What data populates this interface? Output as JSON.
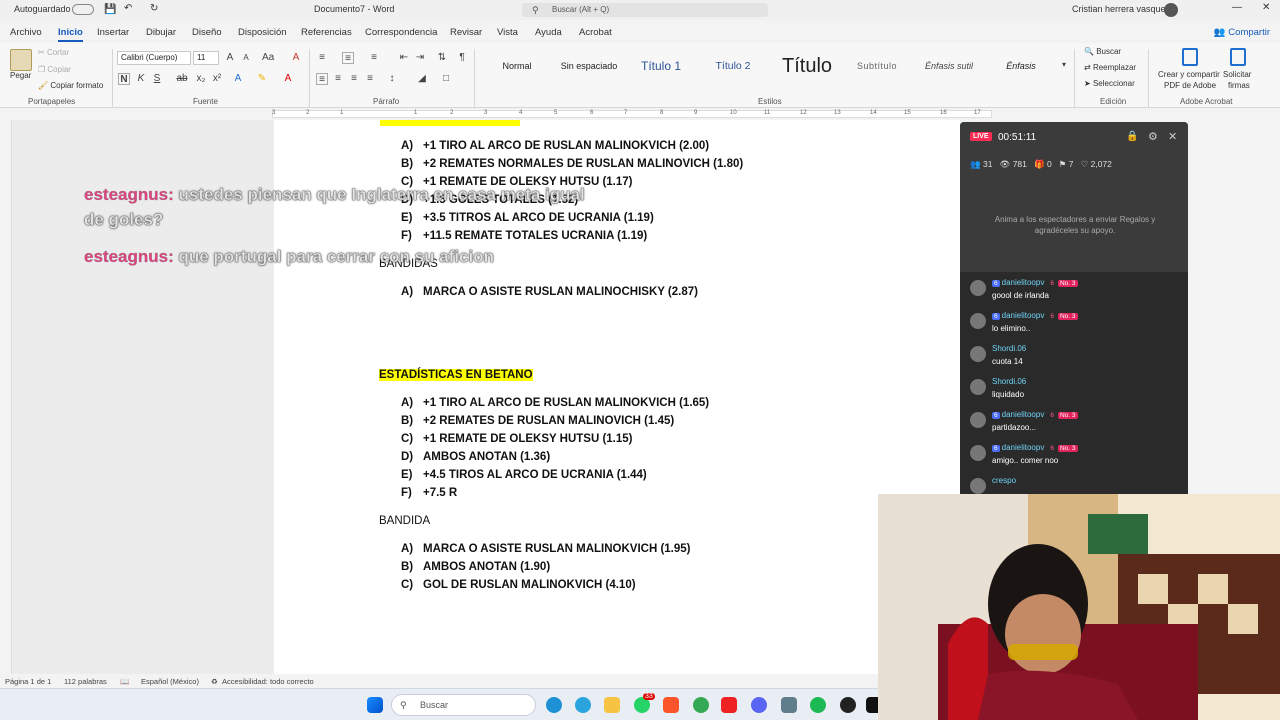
{
  "titlebar": {
    "autosave": "Autoguardado",
    "doc_title": "Documento7 - Word",
    "search_placeholder": "Buscar (Alt + Q)",
    "user_name": "Cristian herrera vasquez"
  },
  "tabs": [
    "Archivo",
    "Inicio",
    "Insertar",
    "Dibujar",
    "Diseño",
    "Disposición",
    "Referencias",
    "Correspondencia",
    "Revisar",
    "Vista",
    "Ayuda",
    "Acrobat"
  ],
  "share_label": "Compartir",
  "ribbon": {
    "clipboard": {
      "paste": "Pegar",
      "cut": "Cortar",
      "copy": "Copiar",
      "format_painter": "Copiar formato",
      "group": "Portapapeles"
    },
    "font": {
      "name": "Calibri (Cuerpo)",
      "size": "11",
      "group": "Fuente"
    },
    "paragraph": {
      "group": "Párrafo"
    },
    "styles": {
      "items": [
        "Normal",
        "Sin espaciado",
        "Título 1",
        "Título 2",
        "Título",
        "Subtítulo",
        "Énfasis sutil",
        "Énfasis"
      ],
      "group": "Estilos"
    },
    "editing": {
      "find": "Buscar",
      "replace": "Reemplazar",
      "select": "Seleccionar",
      "group": "Edición"
    },
    "acrobat": {
      "create": "Crear y compartir",
      "create2": "PDF de Adobe",
      "sign": "Solicitar",
      "sign2": "firmas",
      "group": "Adobe Acrobat"
    }
  },
  "ruler_numbers": [
    "3",
    "2",
    "1",
    "1",
    "2",
    "3",
    "4",
    "5",
    "6",
    "7",
    "8",
    "9",
    "10",
    "11",
    "12",
    "13",
    "14",
    "15",
    "16",
    "17"
  ],
  "document": {
    "section1_items": [
      {
        "letter": "A)",
        "text": "+1 TIRO AL ARCO DE RUSLAN MALINOKVICH (2.00)"
      },
      {
        "letter": "B)",
        "text": "+2 REMATES NORMALES DE RUSLAN MALINOVICH (1.80)"
      },
      {
        "letter": "C)",
        "text": "+1 REMATE DE OLEKSY HUTSU (1.17)"
      },
      {
        "letter": "D)",
        "text": "+1.5 GOLES TOTALES (1.52)"
      },
      {
        "letter": "E)",
        "text": "+3.5 TITROS AL ARCO DE UCRANIA (1.19)"
      },
      {
        "letter": "F)",
        "text": "+11.5 REMATE TOTALES UCRANIA (1.19)"
      }
    ],
    "bandidas_heading": "BANDIDAS",
    "bandidas_items": [
      {
        "letter": "A)",
        "text": "MARCA O ASISTE RUSLAN MALINOCHISKY (2.87)"
      }
    ],
    "betano_heading": "ESTADÍSTICAS EN BETANO",
    "betano_items": [
      {
        "letter": "A)",
        "text": "+1 TIRO AL ARCO DE RUSLAN MALINOKVICH (1.65)"
      },
      {
        "letter": "B)",
        "text": "+2 REMATES DE RUSLAN MALINOVICH (1.45)"
      },
      {
        "letter": "C)",
        "text": "+1 REMATE DE OLEKSY HUTSU (1.15)"
      },
      {
        "letter": "D)",
        "text": "AMBOS ANOTAN (1.36)"
      },
      {
        "letter": "E)",
        "text": "+4.5 TIROS AL ARCO DE UCRANIA (1.44)"
      },
      {
        "letter": "F)",
        "text": "+7.5 R"
      }
    ],
    "bandida_heading": "BANDIDA",
    "bandida_items": [
      {
        "letter": "A)",
        "text": "MARCA O ASISTE RUSLAN MALINOKVICH (1.95)"
      },
      {
        "letter": "B)",
        "text": "AMBOS ANOTAN (1.90)"
      },
      {
        "letter": "C)",
        "text": "GOL DE RUSLAN MALINOKVICH (4.10)"
      }
    ]
  },
  "overlay_comments": [
    {
      "user": "esteagnus:",
      "message": "ustedes piensan que Inglaterra en casa meta igual",
      "message2": "de goles?"
    },
    {
      "user": "esteagnus:",
      "message": "que portugal para cerrar con su aficion"
    }
  ],
  "statusbar": {
    "page": "Página 1 de 1",
    "words": "112 palabras",
    "language": "Español (México)",
    "accessibility": "Accesibilidad: todo correcto"
  },
  "taskbar": {
    "search_placeholder": "Buscar",
    "badge": "33"
  },
  "live": {
    "badge": "LIVE",
    "timer": "00:51:11",
    "stats": {
      "members": "31",
      "viewers": "781",
      "gifts": "0",
      "shares": "7",
      "likes": "2,072"
    },
    "invite_text": "Anima a los espectadores a enviar Regalos y agradéceles su apoyo.",
    "chat": [
      {
        "name": "danielitoopv",
        "level": "6",
        "fan": "6",
        "rank": "No. 3",
        "message": "goool de irlanda"
      },
      {
        "name": "danielitoopv",
        "level": "6",
        "fan": "6",
        "rank": "No. 3",
        "message": "lo elimino.."
      },
      {
        "name": "Shordi.06",
        "message": "cuota 14"
      },
      {
        "name": "Shordi.06",
        "message": "liquidado"
      },
      {
        "name": "danielitoopv",
        "level": "6",
        "fan": "6",
        "rank": "No. 3",
        "message": "partidazoo..."
      },
      {
        "name": "danielitoopv",
        "level": "6",
        "fan": "6",
        "rank": "No. 3",
        "message": "amigo.. comer noo"
      },
      {
        "name": "crespo",
        "message": ""
      }
    ]
  },
  "colors": {
    "accent": "#185abd",
    "highlight": "#ffff00",
    "live_red": "#fe2c55",
    "chat_name": "#6fd3f6",
    "overlay_user": "#e3427f"
  }
}
